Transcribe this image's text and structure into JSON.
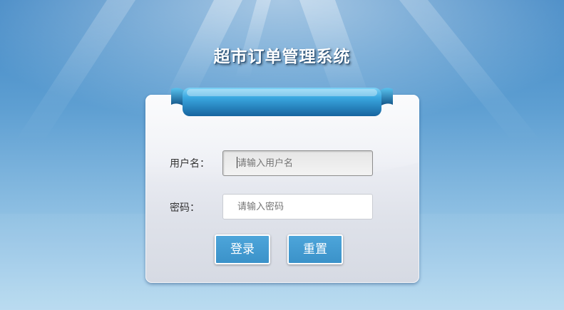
{
  "app": {
    "title": "超市订单管理系统"
  },
  "login_form": {
    "username_label": "用户名：",
    "username_placeholder": "请输入用户名",
    "username_value": "",
    "password_label": "密码：",
    "password_placeholder": "请输入密码",
    "password_value": "",
    "login_button": "登录",
    "reset_button": "重置"
  },
  "colors": {
    "background_top": "#3f86c4",
    "background_bottom": "#b7daf0",
    "button": "#4da5da",
    "ribbon": "#2a86c7"
  }
}
